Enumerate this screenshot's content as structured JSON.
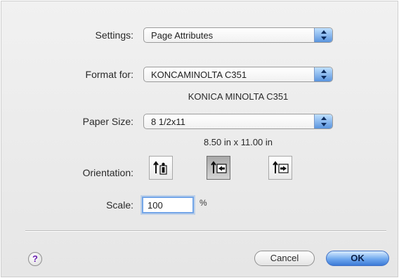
{
  "settings": {
    "label": "Settings:",
    "value": "Page Attributes"
  },
  "format": {
    "label": "Format for:",
    "value": "KONCAMINOLTA C351",
    "subtext": "KONICA MINOLTA C351"
  },
  "paper": {
    "label": "Paper Size:",
    "value": "8 1/2x11",
    "subtext": "8.50 in x 11.00 in"
  },
  "orientation": {
    "label": "Orientation:",
    "options": [
      {
        "name": "portrait",
        "icon": "portrait-orientation-icon"
      },
      {
        "name": "landscape-left",
        "icon": "landscape-left-orientation-icon",
        "selected": true
      },
      {
        "name": "landscape-right",
        "icon": "landscape-right-orientation-icon"
      }
    ]
  },
  "scale": {
    "label": "Scale:",
    "value": "100",
    "unit": "%"
  },
  "buttons": {
    "help": "?",
    "cancel": "Cancel",
    "ok": "OK"
  },
  "colors": {
    "accent_blue": "#5a94de",
    "focus_ring": "#74a6e8",
    "help_question": "#6a1fb0"
  }
}
